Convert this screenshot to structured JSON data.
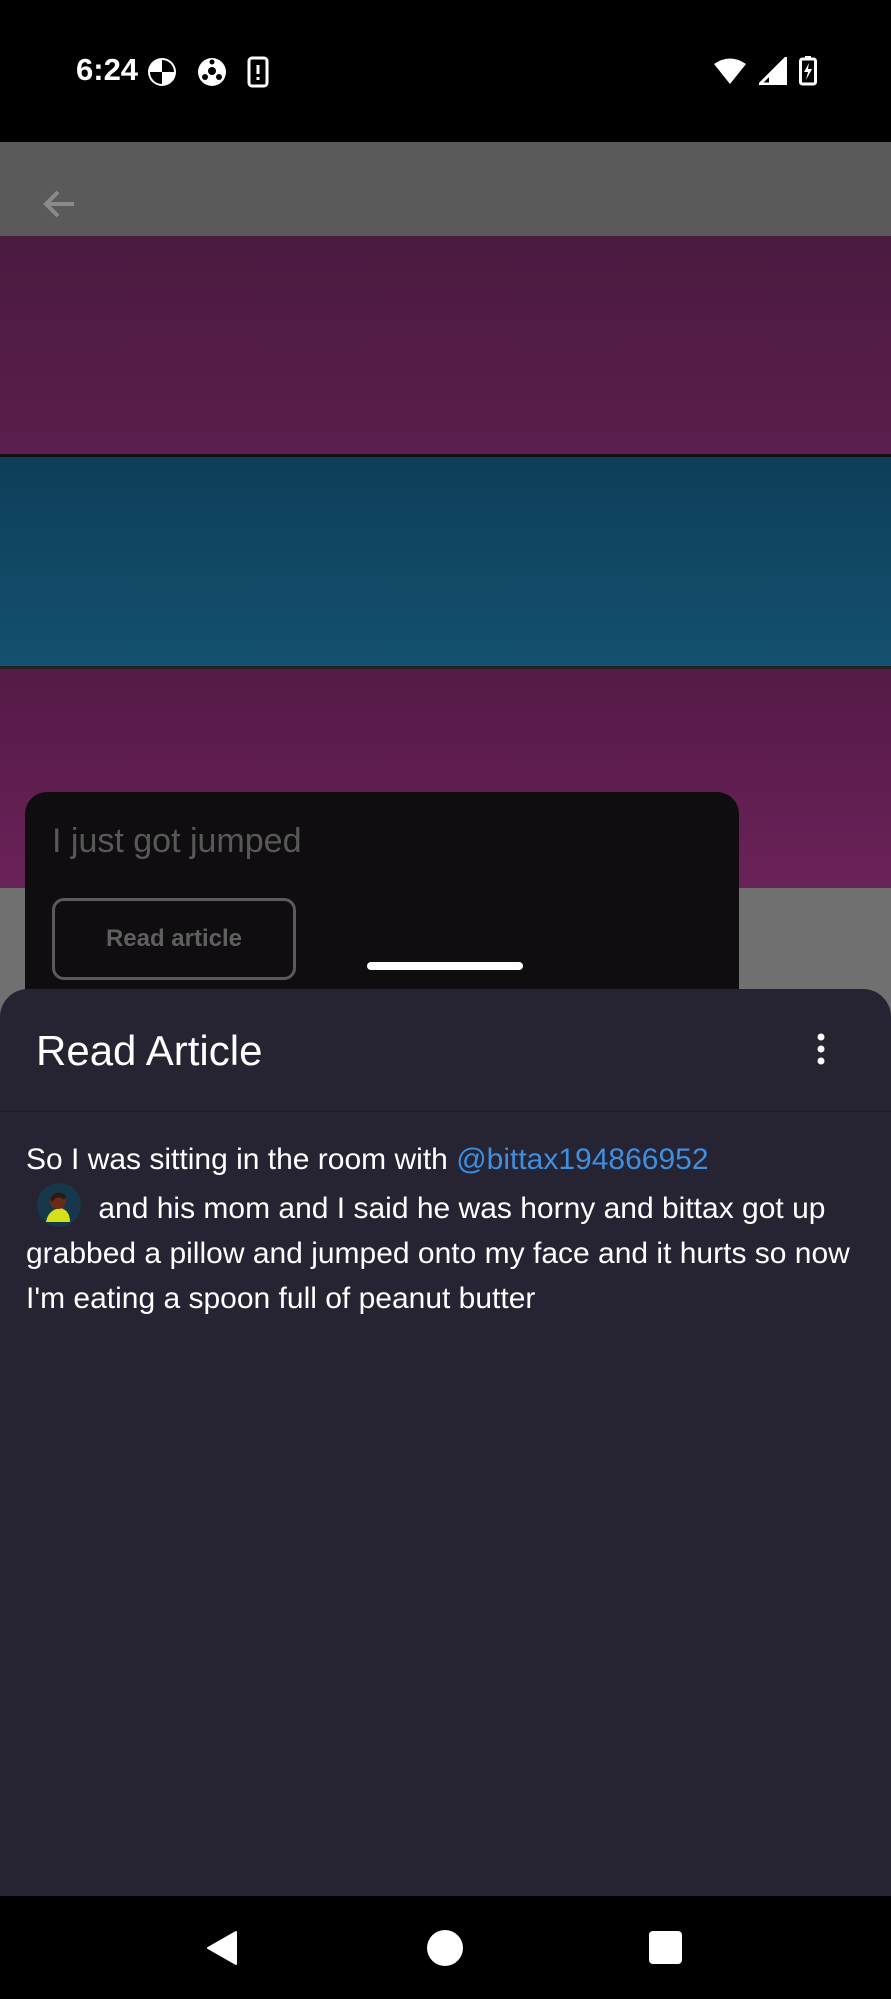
{
  "status_bar": {
    "time": "6:24",
    "left_icons": [
      "media-icon",
      "soccer-ball-icon",
      "alert-phone-icon"
    ],
    "right_icons": [
      "wifi-icon",
      "signal-icon",
      "battery-charging-icon"
    ]
  },
  "background_page": {
    "card_title": "I just got jumped",
    "card_button_label": "Read article"
  },
  "sheet": {
    "title": "Read Article",
    "body_before_mention": "So I was sitting in the room with ",
    "mention": "@bittax194866952",
    "body_after_mention": " and his mom and I said he was horny and bittax got up grabbed a pillow and jumped onto my face and it hurts so now I'm eating a spoon full of peanut butter"
  },
  "colors": {
    "sheet_bg": "#262333",
    "mention": "#3d8fe0",
    "stripe_purple": "#5c1e4e",
    "stripe_blue": "#145170"
  }
}
